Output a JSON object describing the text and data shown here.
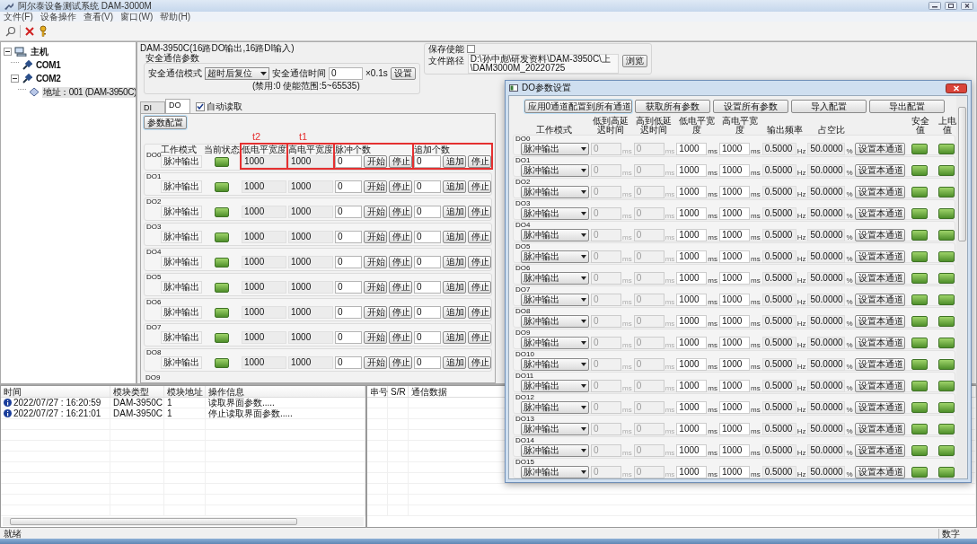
{
  "window": {
    "title": "阿尔泰设备测试系统 DAM-3000M"
  },
  "menu": [
    "文件(F)",
    "设备操作",
    "查看(V)",
    "窗口(W)",
    "帮助(H)"
  ],
  "tree": [
    {
      "kind": "host",
      "label": "主机",
      "expanded": true,
      "selected": false,
      "children": [
        {
          "kind": "port",
          "label": "COM1",
          "selected": false
        },
        {
          "kind": "port",
          "label": "COM2",
          "expanded": true,
          "selected": false,
          "children": [
            {
              "kind": "device",
              "label": "地址：001 (DAM-3950C)",
              "selected": true
            }
          ]
        }
      ]
    }
  ],
  "device_title": "DAM-3950C(16路DO输出,16路DI输入)",
  "safety": {
    "title": "安全通信参数",
    "mode_label": "安全通信模式",
    "mode_value": "超时后复位",
    "time_label": "安全通信时间",
    "time_value": "0",
    "unit": "×0.1s",
    "set_button": "设置",
    "hint": "(禁用:0 使能范围:5~65535)"
  },
  "save": {
    "enable_label": "保存使能",
    "enable_checked": false,
    "path_label": "文件路径",
    "path_lines": [
      "D:\\孙中彪\\研发资料\\DAM-3950C\\上",
      "\\DAM3000M_20220725"
    ],
    "browse_button": "浏览"
  },
  "tabs": [
    {
      "label": "DI",
      "selected": false
    },
    {
      "label": "DO",
      "selected": true
    }
  ],
  "auto_read": {
    "label": "自动读取",
    "checked": true
  },
  "config_button": "参数配置",
  "channel_headers": [
    "工作模式",
    "当前状态",
    "低电平宽度",
    "高电平宽度",
    "脉冲个数",
    "追加个数"
  ],
  "annotations": [
    {
      "kind": "box",
      "label": "t2"
    },
    {
      "kind": "box",
      "label": "t1"
    },
    {
      "kind": "box"
    },
    {
      "kind": "box"
    }
  ],
  "channels": [
    {
      "name": "DO0",
      "mode": "脉冲输出",
      "on": true,
      "low": "1000",
      "high": "1000",
      "pulse": "0",
      "append": "0",
      "buttons": [
        "开始",
        "停止",
        "追加",
        "停止"
      ]
    },
    {
      "name": "DO1",
      "mode": "脉冲输出",
      "on": true,
      "low": "1000",
      "high": "1000",
      "pulse": "0",
      "append": "0",
      "buttons": [
        "开始",
        "停止",
        "追加",
        "停止"
      ]
    },
    {
      "name": "DO2",
      "mode": "脉冲输出",
      "on": true,
      "low": "1000",
      "high": "1000",
      "pulse": "0",
      "append": "0",
      "buttons": [
        "开始",
        "停止",
        "追加",
        "停止"
      ]
    },
    {
      "name": "DO3",
      "mode": "脉冲输出",
      "on": true,
      "low": "1000",
      "high": "1000",
      "pulse": "0",
      "append": "0",
      "buttons": [
        "开始",
        "停止",
        "追加",
        "停止"
      ]
    },
    {
      "name": "DO4",
      "mode": "脉冲输出",
      "on": true,
      "low": "1000",
      "high": "1000",
      "pulse": "0",
      "append": "0",
      "buttons": [
        "开始",
        "停止",
        "追加",
        "停止"
      ]
    },
    {
      "name": "DO5",
      "mode": "脉冲输出",
      "on": true,
      "low": "1000",
      "high": "1000",
      "pulse": "0",
      "append": "0",
      "buttons": [
        "开始",
        "停止",
        "追加",
        "停止"
      ]
    },
    {
      "name": "DO6",
      "mode": "脉冲输出",
      "on": true,
      "low": "1000",
      "high": "1000",
      "pulse": "0",
      "append": "0",
      "buttons": [
        "开始",
        "停止",
        "追加",
        "停止"
      ]
    },
    {
      "name": "DO7",
      "mode": "脉冲输出",
      "on": true,
      "low": "1000",
      "high": "1000",
      "pulse": "0",
      "append": "0",
      "buttons": [
        "开始",
        "停止",
        "追加",
        "停止"
      ]
    },
    {
      "name": "DO8",
      "mode": "脉冲输出",
      "on": true,
      "low": "1000",
      "high": "1000",
      "pulse": "0",
      "append": "0",
      "buttons": [
        "开始",
        "停止",
        "追加",
        "停止"
      ]
    }
  ],
  "next_channel_label": "DO9",
  "log": {
    "columns": [
      "时间",
      "模块类型",
      "模块地址",
      "操作信息"
    ],
    "rows": [
      {
        "kind": "info",
        "cells": [
          "2022/07/27 : 16:20:59",
          "DAM-3950C",
          "1",
          "读取界面参数....."
        ]
      },
      {
        "kind": "info",
        "cells": [
          "2022/07/27 : 16:21:01",
          "DAM-3950C",
          "1",
          "停止读取界面参数....."
        ]
      }
    ]
  },
  "comm": {
    "columns": [
      "串号",
      "S/R",
      "通信数据"
    ]
  },
  "dialog": {
    "title": "DO参数设置",
    "buttons": [
      "应用0通道配置到所有通道",
      "获取所有参数",
      "设置所有参数",
      "导入配置",
      "导出配置"
    ],
    "headers": [
      "工作模式",
      "低到高延迟时间",
      "高到低延迟时间",
      "低电平宽度",
      "高电平宽度",
      "输出频率",
      "占空比",
      "安全值",
      "上电值"
    ],
    "rows": [
      {
        "name": "DO0",
        "mode": "脉冲输出",
        "delay_lh": "0",
        "delay_hl": "0",
        "delays_disabled": true,
        "low": "1000",
        "high": "1000",
        "freq": "0.5000",
        "duty": "50.0000",
        "units": [
          "ms",
          "ms",
          "ms",
          "ms",
          "Hz",
          "%"
        ],
        "set_button": "设置本通道",
        "safe_on": true,
        "power_on": true
      },
      {
        "name": "DO1",
        "mode": "脉冲输出",
        "delay_lh": "0",
        "delay_hl": "0",
        "delays_disabled": true,
        "low": "1000",
        "high": "1000",
        "freq": "0.5000",
        "duty": "50.0000",
        "units": [
          "ms",
          "ms",
          "ms",
          "ms",
          "Hz",
          "%"
        ],
        "set_button": "设置本通道",
        "safe_on": true,
        "power_on": true
      },
      {
        "name": "DO2",
        "mode": "脉冲输出",
        "delay_lh": "0",
        "delay_hl": "0",
        "delays_disabled": true,
        "low": "1000",
        "high": "1000",
        "freq": "0.5000",
        "duty": "50.0000",
        "units": [
          "ms",
          "ms",
          "ms",
          "ms",
          "Hz",
          "%"
        ],
        "set_button": "设置本通道",
        "safe_on": true,
        "power_on": true
      },
      {
        "name": "DO3",
        "mode": "脉冲输出",
        "delay_lh": "0",
        "delay_hl": "0",
        "delays_disabled": true,
        "low": "1000",
        "high": "1000",
        "freq": "0.5000",
        "duty": "50.0000",
        "units": [
          "ms",
          "ms",
          "ms",
          "ms",
          "Hz",
          "%"
        ],
        "set_button": "设置本通道",
        "safe_on": true,
        "power_on": true
      },
      {
        "name": "DO4",
        "mode": "脉冲输出",
        "delay_lh": "0",
        "delay_hl": "0",
        "delays_disabled": true,
        "low": "1000",
        "high": "1000",
        "freq": "0.5000",
        "duty": "50.0000",
        "units": [
          "ms",
          "ms",
          "ms",
          "ms",
          "Hz",
          "%"
        ],
        "set_button": "设置本通道",
        "safe_on": true,
        "power_on": true
      },
      {
        "name": "DO5",
        "mode": "脉冲输出",
        "delay_lh": "0",
        "delay_hl": "0",
        "delays_disabled": true,
        "low": "1000",
        "high": "1000",
        "freq": "0.5000",
        "duty": "50.0000",
        "units": [
          "ms",
          "ms",
          "ms",
          "ms",
          "Hz",
          "%"
        ],
        "set_button": "设置本通道",
        "safe_on": true,
        "power_on": true
      },
      {
        "name": "DO6",
        "mode": "脉冲输出",
        "delay_lh": "0",
        "delay_hl": "0",
        "delays_disabled": true,
        "low": "1000",
        "high": "1000",
        "freq": "0.5000",
        "duty": "50.0000",
        "units": [
          "ms",
          "ms",
          "ms",
          "ms",
          "Hz",
          "%"
        ],
        "set_button": "设置本通道",
        "safe_on": true,
        "power_on": true
      },
      {
        "name": "DO7",
        "mode": "脉冲输出",
        "delay_lh": "0",
        "delay_hl": "0",
        "delays_disabled": true,
        "low": "1000",
        "high": "1000",
        "freq": "0.5000",
        "duty": "50.0000",
        "units": [
          "ms",
          "ms",
          "ms",
          "ms",
          "Hz",
          "%"
        ],
        "set_button": "设置本通道",
        "safe_on": true,
        "power_on": true
      },
      {
        "name": "DO8",
        "mode": "脉冲输出",
        "delay_lh": "0",
        "delay_hl": "0",
        "delays_disabled": true,
        "low": "1000",
        "high": "1000",
        "freq": "0.5000",
        "duty": "50.0000",
        "units": [
          "ms",
          "ms",
          "ms",
          "ms",
          "Hz",
          "%"
        ],
        "set_button": "设置本通道",
        "safe_on": true,
        "power_on": true
      },
      {
        "name": "DO9",
        "mode": "脉冲输出",
        "delay_lh": "0",
        "delay_hl": "0",
        "delays_disabled": true,
        "low": "1000",
        "high": "1000",
        "freq": "0.5000",
        "duty": "50.0000",
        "units": [
          "ms",
          "ms",
          "ms",
          "ms",
          "Hz",
          "%"
        ],
        "set_button": "设置本通道",
        "safe_on": true,
        "power_on": true
      },
      {
        "name": "DO10",
        "mode": "脉冲输出",
        "delay_lh": "0",
        "delay_hl": "0",
        "delays_disabled": true,
        "low": "1000",
        "high": "1000",
        "freq": "0.5000",
        "duty": "50.0000",
        "units": [
          "ms",
          "ms",
          "ms",
          "ms",
          "Hz",
          "%"
        ],
        "set_button": "设置本通道",
        "safe_on": true,
        "power_on": true
      },
      {
        "name": "DO11",
        "mode": "脉冲输出",
        "delay_lh": "0",
        "delay_hl": "0",
        "delays_disabled": true,
        "low": "1000",
        "high": "1000",
        "freq": "0.5000",
        "duty": "50.0000",
        "units": [
          "ms",
          "ms",
          "ms",
          "ms",
          "Hz",
          "%"
        ],
        "set_button": "设置本通道",
        "safe_on": true,
        "power_on": true
      },
      {
        "name": "DO12",
        "mode": "脉冲输出",
        "delay_lh": "0",
        "delay_hl": "0",
        "delays_disabled": true,
        "low": "1000",
        "high": "1000",
        "freq": "0.5000",
        "duty": "50.0000",
        "units": [
          "ms",
          "ms",
          "ms",
          "ms",
          "Hz",
          "%"
        ],
        "set_button": "设置本通道",
        "safe_on": true,
        "power_on": true
      },
      {
        "name": "DO13",
        "mode": "脉冲输出",
        "delay_lh": "0",
        "delay_hl": "0",
        "delays_disabled": true,
        "low": "1000",
        "high": "1000",
        "freq": "0.5000",
        "duty": "50.0000",
        "units": [
          "ms",
          "ms",
          "ms",
          "ms",
          "Hz",
          "%"
        ],
        "set_button": "设置本通道",
        "safe_on": true,
        "power_on": true
      },
      {
        "name": "DO14",
        "mode": "脉冲输出",
        "delay_lh": "0",
        "delay_hl": "0",
        "delays_disabled": true,
        "low": "1000",
        "high": "1000",
        "freq": "0.5000",
        "duty": "50.0000",
        "units": [
          "ms",
          "ms",
          "ms",
          "ms",
          "Hz",
          "%"
        ],
        "set_button": "设置本通道",
        "safe_on": true,
        "power_on": true
      },
      {
        "name": "DO15",
        "mode": "脉冲输出",
        "delay_lh": "0",
        "delay_hl": "0",
        "delays_disabled": true,
        "low": "1000",
        "high": "1000",
        "freq": "0.5000",
        "duty": "50.0000",
        "units": [
          "ms",
          "ms",
          "ms",
          "ms",
          "Hz",
          "%"
        ],
        "set_button": "设置本通道",
        "safe_on": true,
        "power_on": true
      }
    ]
  },
  "status_bar": {
    "left": "就绪",
    "right": "数字"
  }
}
